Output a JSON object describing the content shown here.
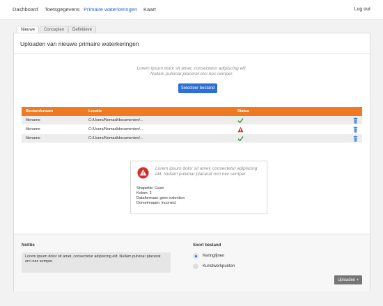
{
  "nav": {
    "items": [
      {
        "label": "Dashboard"
      },
      {
        "label": "Toetsgegevens"
      },
      {
        "label": "Primaire waterkeringen"
      },
      {
        "label": "Kaart"
      }
    ],
    "logout": "Log out"
  },
  "tabs": [
    {
      "label": "Nieuwe"
    },
    {
      "label": "Concepten"
    },
    {
      "label": "Definitieve"
    }
  ],
  "card": {
    "title": "Uploaden van nieuwe primaire waterkeringen",
    "intro_line1": "Lorem ipsum dolor sit amet, consectetur adipiscing elit.",
    "intro_line2": "Nullam pulvinar placerat orci nec semper.",
    "select_button": "Selecteer bestand"
  },
  "table": {
    "headers": {
      "name": "Bestandsnaam",
      "location": "Locatie",
      "status": "Status"
    },
    "rows": [
      {
        "name": "filename",
        "location": "C:/Users/Nomad/documenten/...",
        "status": "ok"
      },
      {
        "name": "filename",
        "location": "C:/Users/Nomad/documenten/...",
        "status": "error"
      },
      {
        "name": "filename",
        "location": "C:/Users/Nomad/documenten/...",
        "status": "ok"
      }
    ]
  },
  "error_box": {
    "line1": "Lorem ipsum dolor sit amet, consectetur adipiscing",
    "line2": "elit. Nullam pulvinar placerat orci nec semper.",
    "shapefile": "Shapefile: Geen",
    "kolom": "Kolom: 2",
    "dataformaat": "Dataformaat: geen extention",
    "domeinnaam": "Domeinnaam: incorrect"
  },
  "footer": {
    "notitie_label": "Notitie",
    "notitie_text": "Lorem ipsum dolor sit amet, consectetur adipiscing elit. Nullam pulvinar placerat orci nec semper.",
    "soort_label": "Soort bestand",
    "options": [
      {
        "label": "Keringlijnen",
        "checked": true
      },
      {
        "label": "Kunstwerkpunten",
        "checked": false
      }
    ],
    "upload_button": "Uploaden +"
  },
  "colors": {
    "accent": "#2f6fd3",
    "table_header": "#f07a22",
    "ok": "#2e9e3f",
    "error": "#d32f2f"
  }
}
